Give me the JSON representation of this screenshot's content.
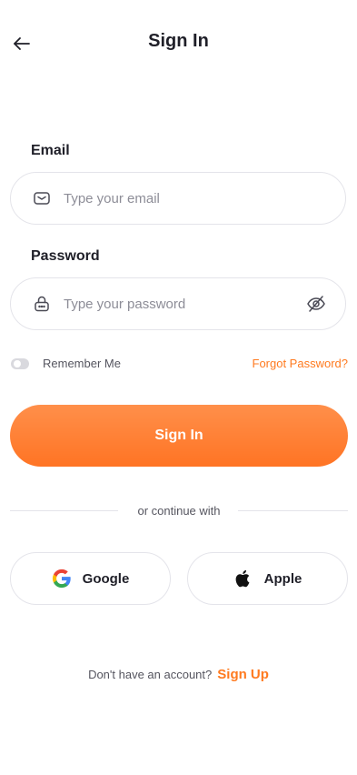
{
  "header": {
    "title": "Sign In",
    "back_icon": "arrow-left-icon"
  },
  "email": {
    "label": "Email",
    "placeholder": "Type your email",
    "value": "",
    "icon": "envelope-icon"
  },
  "password": {
    "label": "Password",
    "placeholder": "Type your password",
    "value": "",
    "icon": "lock-icon",
    "toggle_icon": "eye-off-icon"
  },
  "remember": {
    "label": "Remember Me",
    "checked": false
  },
  "forgot_label": "Forgot Password?",
  "primary_button": {
    "label": "Sign In"
  },
  "divider_text": "or continue with",
  "social": [
    {
      "label": "Google",
      "icon": "google-icon"
    },
    {
      "label": "Apple",
      "icon": "apple-icon"
    }
  ],
  "footer": {
    "prompt": "Don't have an account?",
    "link": "Sign Up"
  },
  "colors": {
    "accent": "#ff7a1f",
    "accent_gradient_top": "#ff8f4a",
    "accent_gradient_bottom": "#ff7424",
    "text": "#1f1f28",
    "muted": "#8d8d97",
    "border": "#e4e4ea"
  }
}
